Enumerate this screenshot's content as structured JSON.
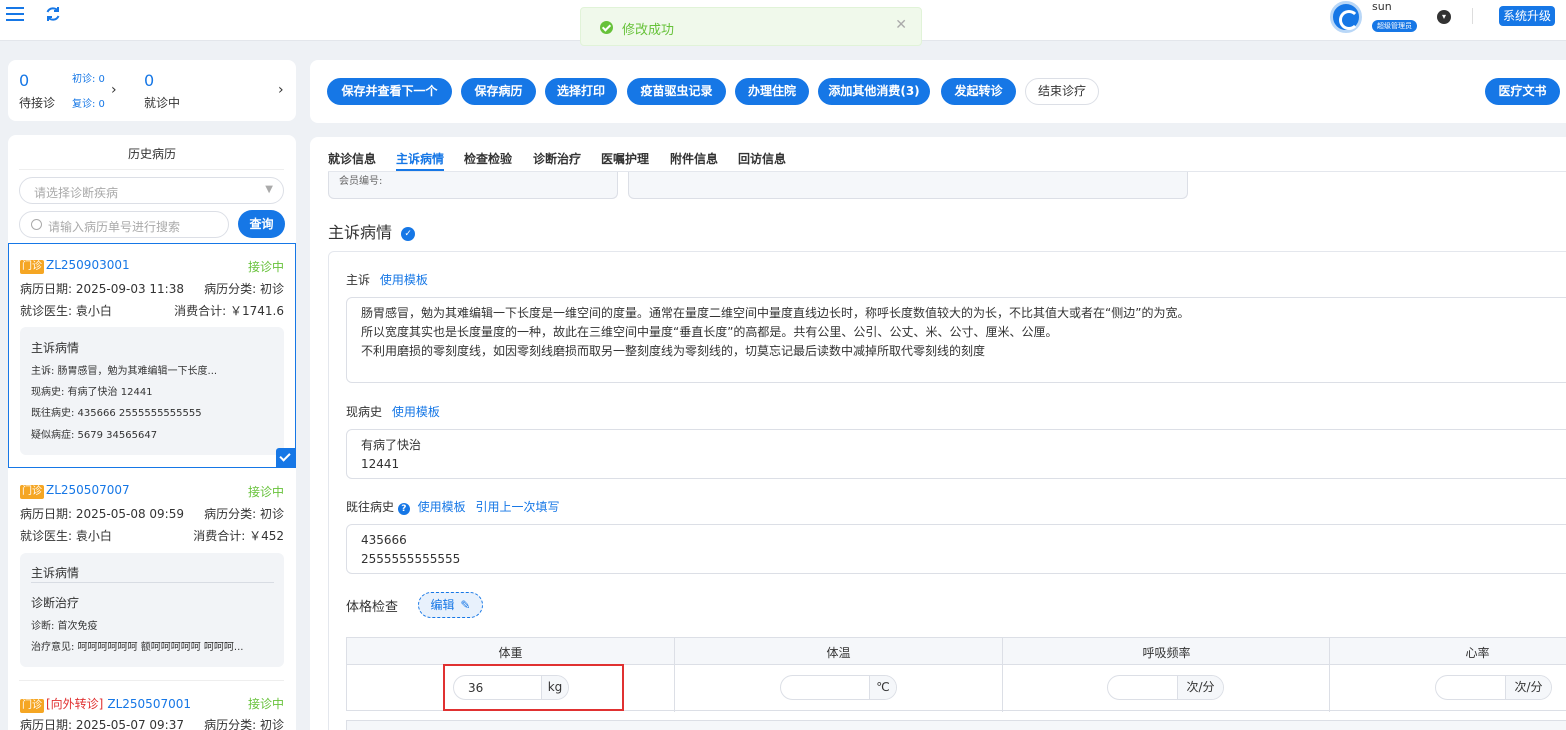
{
  "toast": {
    "message": "修改成功"
  },
  "user": {
    "name": "sun",
    "role": "超级管理员",
    "upgrade": "系统升级"
  },
  "queue": {
    "waiting_count": "0",
    "waiting_label": "待接诊",
    "first_visit": "初诊: 0",
    "revisit": "复诊: 0",
    "in_progress_count": "0",
    "in_progress_label": "就诊中"
  },
  "actions": {
    "save_next": "保存并查看下一个",
    "save_record": "保存病历",
    "print": "选择打印",
    "vaccine": "疫苗驱虫记录",
    "hospitalize": "办理住院",
    "add_other": "添加其他消费(3)",
    "transfer": "发起转诊",
    "end": "结束诊疗",
    "docs": "医疗文书"
  },
  "tabs": [
    "就诊信息",
    "主诉病情",
    "检查检验",
    "诊断治疗",
    "医嘱护理",
    "附件信息",
    "回访信息"
  ],
  "history": {
    "title": "历史病历",
    "disease_placeholder": "请选择诊断疾病",
    "search_placeholder": "请输入病历单号进行搜索",
    "search_button": "查询",
    "records": [
      {
        "tag": "门诊",
        "transfer": "",
        "no": "ZL250903001",
        "status": "接诊中",
        "date": "病历日期: 2025-09-03 11:38",
        "category": "病历分类: 初诊",
        "doctor": "就诊医生: 袁小白",
        "cost": "消费合计: ￥1741.6",
        "detail_title": "主诉病情",
        "lines": [
          "主诉:  肠胃感冒，勉为其难编辑一下长度...",
          "现病史:  有病了快治 12441",
          "既往病史:  435666 2555555555555",
          "疑似病症:  5679 34565647"
        ]
      },
      {
        "tag": "门诊",
        "transfer": "",
        "no": "ZL250507007",
        "status": "接诊中",
        "date": "病历日期: 2025-05-08 09:59",
        "category": "病历分类: 初诊",
        "doctor": "就诊医生: 袁小白",
        "cost": "消费合计: ￥452",
        "detail_title": "主诉病情",
        "detail_title2": "诊断治疗",
        "lines": [
          "诊断: 首次免疫",
          "治疗意见:  呵呵呵呵呵呵 额呵呵呵呵呵 呵呵呵..."
        ]
      },
      {
        "tag": "门诊",
        "transfer": "[向外转诊]",
        "no": "ZL250507001",
        "status": "接诊中",
        "date": "病历日期: 2025-05-07 09:37",
        "category": "病历分类: 初诊"
      }
    ]
  },
  "main": {
    "member_label": "会员编号:",
    "section_title": "主诉病情",
    "complaint_label": "主诉",
    "use_template": "使用模板",
    "complaint_lines": [
      "肠胃感冒，勉为其难编辑一下长度是一维空间的度量。通常在量度二维空间中量度直线边长时，称呼长度数值较大的为长，不比其值大或者在“侧边”的为宽。",
      "所以宽度其实也是长度量度的一种，故此在三维空间中量度“垂直长度”的高都是。共有公里、公引、公丈、米、公寸、厘米、公厘。",
      "不利用磨损的零刻度线，如因零刻线磨损而取另一整刻度线为零刻线的，切莫忘记最后读数中减掉所取代零刻线的刻度"
    ],
    "present_label": "现病史",
    "present_lines": [
      "有病了快治",
      "12441"
    ],
    "past_label": "既往病史",
    "use_last": "引用上一次填写",
    "past_lines": [
      "435666",
      "2555555555555"
    ],
    "exam_label": "体格检查",
    "edit_label": "编辑",
    "exam_headers": [
      "体重",
      "体温",
      "呼吸频率",
      "心率"
    ],
    "weight_value": "36",
    "weight_unit": "kg",
    "temp_unit": "℃",
    "resp_unit": "次/分",
    "heart_unit": "次/分"
  },
  "colors": {
    "accent": "#1677e6",
    "success": "#67c23a",
    "tag": "#f5a623",
    "highlight": "#e03131"
  }
}
